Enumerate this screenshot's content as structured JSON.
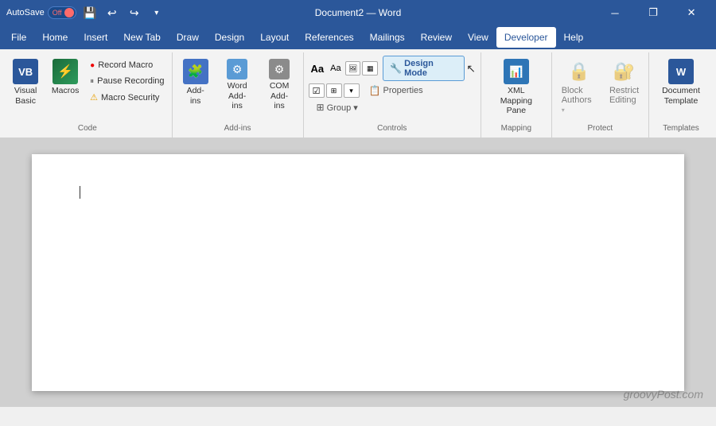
{
  "title_bar": {
    "autosave_label": "AutoSave",
    "autosave_state": "Off",
    "document_title": "Document2 — Word",
    "undo_icon": "↩",
    "redo_icon": "↪",
    "dropdown_icon": "▾"
  },
  "menu": {
    "items": [
      {
        "id": "file",
        "label": "File"
      },
      {
        "id": "home",
        "label": "Home"
      },
      {
        "id": "insert",
        "label": "Insert"
      },
      {
        "id": "new-tab",
        "label": "New Tab"
      },
      {
        "id": "draw",
        "label": "Draw"
      },
      {
        "id": "design",
        "label": "Design"
      },
      {
        "id": "layout",
        "label": "Layout"
      },
      {
        "id": "references",
        "label": "References"
      },
      {
        "id": "mailings",
        "label": "Mailings"
      },
      {
        "id": "review",
        "label": "Review"
      },
      {
        "id": "view",
        "label": "View"
      },
      {
        "id": "developer",
        "label": "Developer"
      },
      {
        "id": "help",
        "label": "Help"
      }
    ],
    "active": "developer"
  },
  "ribbon": {
    "groups": [
      {
        "id": "code",
        "label": "Code",
        "items": {
          "visual_basic_label": "Visual\nBasic",
          "macros_label": "Macros",
          "record_macro_label": "Record Macro",
          "pause_recording_label": "Pause Recording",
          "macro_security_label": "Macro Security"
        }
      },
      {
        "id": "add-ins",
        "label": "Add-ins",
        "items": {
          "add_ins_label": "Add-\nins",
          "word_add_ins_label": "Word\nAdd-ins",
          "com_add_ins_label": "COM\nAdd-ins"
        }
      },
      {
        "id": "controls",
        "label": "Controls",
        "items": {
          "design_mode_label": "Design Mode",
          "properties_label": "Properties",
          "group_label": "Group ▾"
        }
      },
      {
        "id": "mapping",
        "label": "Mapping",
        "items": {
          "xml_mapping_pane_label": "XML Mapping\nPane"
        }
      },
      {
        "id": "protect",
        "label": "Protect",
        "items": {
          "block_authors_label": "Block\nAuthors",
          "restrict_editing_label": "Restrict\nEditing"
        }
      },
      {
        "id": "templates",
        "label": "Templates",
        "items": {
          "document_template_label": "Document\nTemplate"
        }
      }
    ]
  },
  "document": {
    "cursor_visible": true
  },
  "watermark": "groovyPost.com"
}
